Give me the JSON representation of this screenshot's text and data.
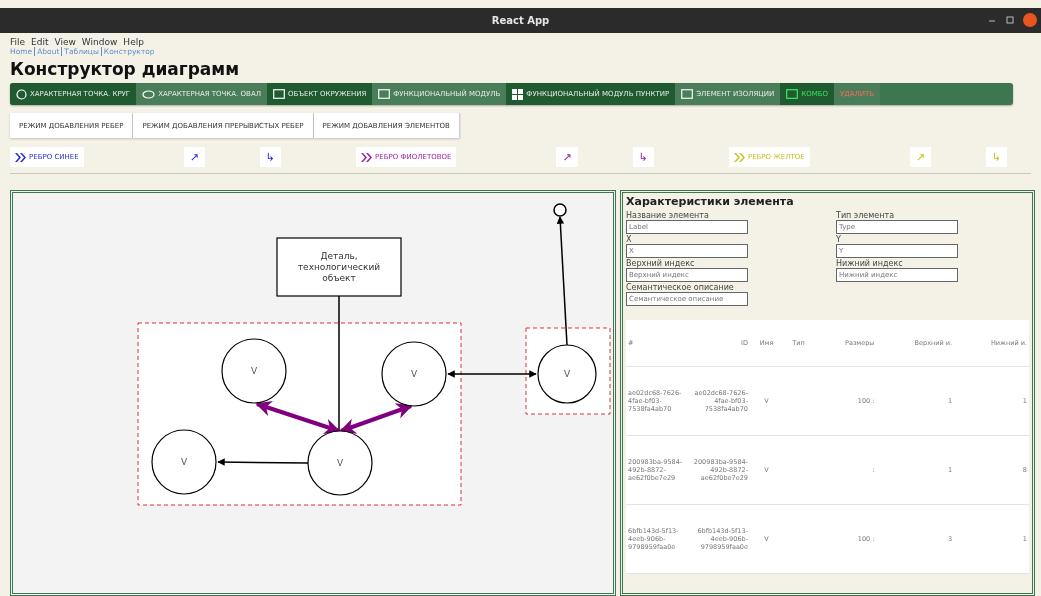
{
  "window": {
    "title": "React App"
  },
  "menu": [
    "File",
    "Edit",
    "View",
    "Window",
    "Help"
  ],
  "breadcrumbs": [
    "Home",
    "About",
    "Таблицы",
    "Конструктор"
  ],
  "heading": "Конструктор диаграмм",
  "element_tools": [
    {
      "label": "ХАРАКТЕРНАЯ ТОЧКА. КРУГ",
      "kind": "circle"
    },
    {
      "label": "ХАРАКТЕРНАЯ ТОЧКА. ОВАЛ",
      "kind": "oval"
    },
    {
      "label": "ОБЪЕКТ ОКРУЖЕНИЯ",
      "kind": "rect"
    },
    {
      "label": "ФУНКЦИОНАЛЬНЫЙ МОДУЛЬ",
      "kind": "rect"
    },
    {
      "label": "ФУНКЦИОНАЛЬНЫЙ МОДУЛЬ ПУНКТИР",
      "kind": "grid"
    },
    {
      "label": "ЭЛЕМЕНТ ИЗОЛЯЦИИ",
      "kind": "rect"
    },
    {
      "label": "КОМБО",
      "kind": "combo"
    },
    {
      "label": "УДАЛИТЬ",
      "kind": "delete"
    }
  ],
  "modes": [
    "РЕЖИМ ДОБАВЛЕНИЯ РЕБЕР",
    "РЕЖИМ ДОБАВЛЕНИЯ ПРЕРЫВИСТЫХ РЕБЕР",
    "РЕЖИМ ДОБАВЛЕНИЯ ЭЛЕМЕНТОВ"
  ],
  "edge_groups": [
    {
      "label": "РЕБРО СИНЕЕ",
      "color": "#2a2ad0",
      "buttons": [
        "↗",
        "↳"
      ]
    },
    {
      "label": "РЕБРО ФИОЛЕТОВОЕ",
      "color": "#a01fa0",
      "buttons": [
        "↗",
        "↳"
      ]
    },
    {
      "label": "РЕБРО ЖЕЛТОЕ",
      "color": "#c9c21e",
      "buttons": [
        "↗",
        "↳"
      ]
    }
  ],
  "diagram": {
    "entity_label": "Деталь, технологический объект",
    "nodes": [
      {
        "label": "V"
      },
      {
        "label": "V"
      },
      {
        "label": "V"
      },
      {
        "label": "V"
      },
      {
        "label": "V"
      }
    ],
    "edges": [
      {
        "color": "#000000"
      },
      {
        "color": "#000000"
      },
      {
        "color": "#000000"
      },
      {
        "color": "#800080"
      },
      {
        "color": "#800080"
      },
      {
        "color": "#000000"
      }
    ]
  },
  "properties": {
    "title": "Характеристики элемента",
    "fields": [
      {
        "label": "Название элемента",
        "placeholder": "Label"
      },
      {
        "label": "Тип элемента",
        "placeholder": "Type"
      },
      {
        "label": "X",
        "placeholder": "X"
      },
      {
        "label": "Y",
        "placeholder": "Y"
      },
      {
        "label": "Верхний индекс",
        "placeholder": "Верхний индекс"
      },
      {
        "label": "Нижний индекс",
        "placeholder": "Нижний индекс"
      },
      {
        "label": "Семантическое описание",
        "placeholder": "Семантическое описание"
      }
    ]
  },
  "table": {
    "columns": [
      "#",
      "ID",
      "Имя",
      "Тип",
      "Размеры",
      "Верхний и.",
      "Нижний и."
    ],
    "rows": [
      [
        "ae02dc68-7626-4fae-bf03-7538fa4ab70",
        "ae02dc68-7626-4fae-bf03-7538fa4ab70",
        "V",
        "",
        "100 :",
        "1",
        "1"
      ],
      [
        "200983ba-9584-492b-8872-ae62f0be7e29",
        "200983ba-9584-492b-8872-ae62f0be7e29",
        "V",
        "",
        ":",
        "1",
        "8"
      ],
      [
        "6bfb143d-5f13-4eeb-906b-9798959faa0e",
        "6bfb143d-5f13-4eeb-906b-9798959faa0e",
        "V",
        "",
        "100 :",
        "3",
        "1"
      ]
    ]
  }
}
